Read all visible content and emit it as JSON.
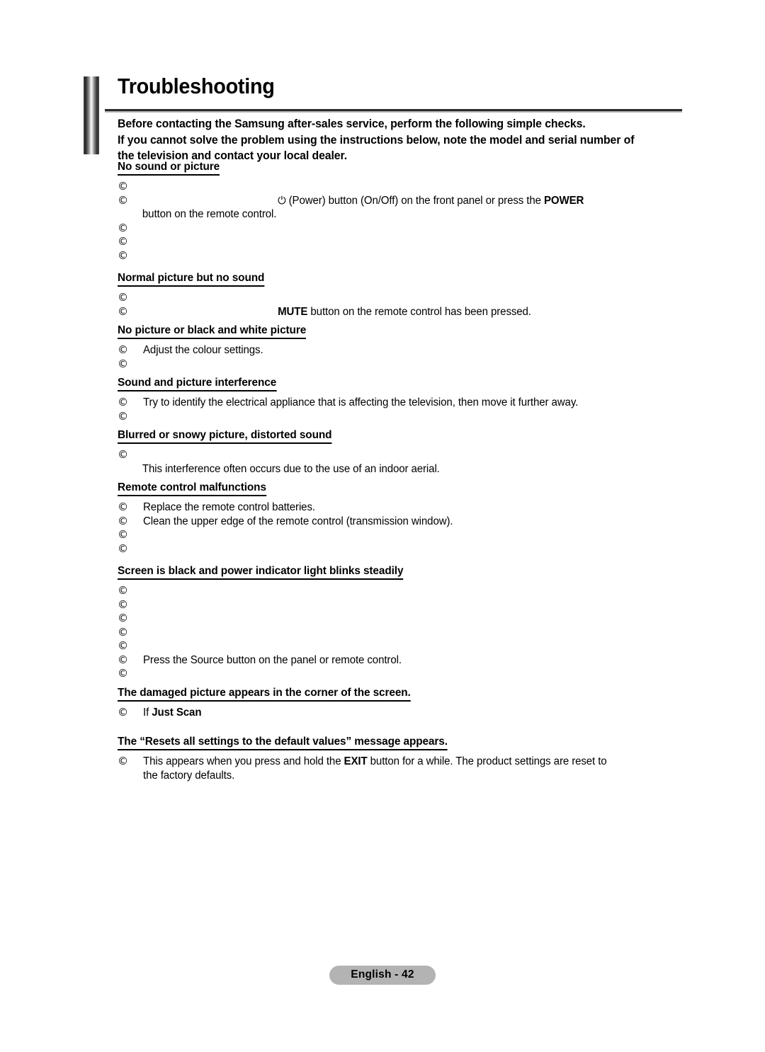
{
  "document": {
    "title": "Troubleshooting",
    "intro_lines": [
      "Before contacting the Samsung after-sales service, perform the following simple checks.",
      "If you cannot solve the problem using the instructions below, note the model and serial number of",
      "the television and contact your local dealer."
    ],
    "bullet_glyph": "©",
    "power_glyph": "⏻"
  },
  "sections": {
    "no_sound_or_picture": {
      "heading": "No sound or picture",
      "bullets": [
        "",
        "",
        "",
        "",
        ""
      ],
      "power_line_prefix": "",
      "power_line_text": " (Power) button (On/Off) on the front panel or press the ",
      "power_line_bold": "POWER",
      "power_continuation": "button on the remote control."
    },
    "normal_picture_no_sound": {
      "heading": "Normal picture but no sound",
      "bullets": [
        "",
        ""
      ],
      "mute_bold": "MUTE",
      "mute_text": " button on the remote control has been pressed."
    },
    "no_picture_black_white": {
      "heading": "No picture or black and white picture",
      "bullets": [
        "Adjust the colour settings.",
        ""
      ]
    },
    "sound_picture_interference": {
      "heading": "Sound and picture interference",
      "bullets": [
        "Try to identify the electrical appliance that is affecting the television, then move it further away.",
        ""
      ]
    },
    "blurred_snowy": {
      "heading": "Blurred or snowy picture, distorted sound",
      "bullets": [
        ""
      ],
      "continuation": "This interference often occurs due to the use of an indoor aerial."
    },
    "remote_malfunctions": {
      "heading": "Remote control malfunctions",
      "bullets": [
        "Replace the remote control batteries.",
        "Clean the upper edge of the remote control (transmission window).",
        "",
        ""
      ]
    },
    "screen_black_blinks": {
      "heading": "Screen is black and power indicator light blinks steadily",
      "bullets": [
        "",
        "",
        "",
        "",
        "",
        "Press the Source button on the panel or remote control.",
        ""
      ]
    },
    "damaged_picture_corner": {
      "heading": "The damaged picture appears in the corner of the screen.",
      "bullet_prefix": "If ",
      "bullet_bold": "Just Scan"
    },
    "resets_message": {
      "heading": "The “Resets all settings to the default values” message appears.",
      "line_1a": "This appears when you press and hold the ",
      "line_1b": "EXIT",
      "line_1c": " button for a while. The product settings are reset to",
      "line_2": "the factory defaults."
    }
  },
  "footer": {
    "page_label": "English - 42"
  }
}
